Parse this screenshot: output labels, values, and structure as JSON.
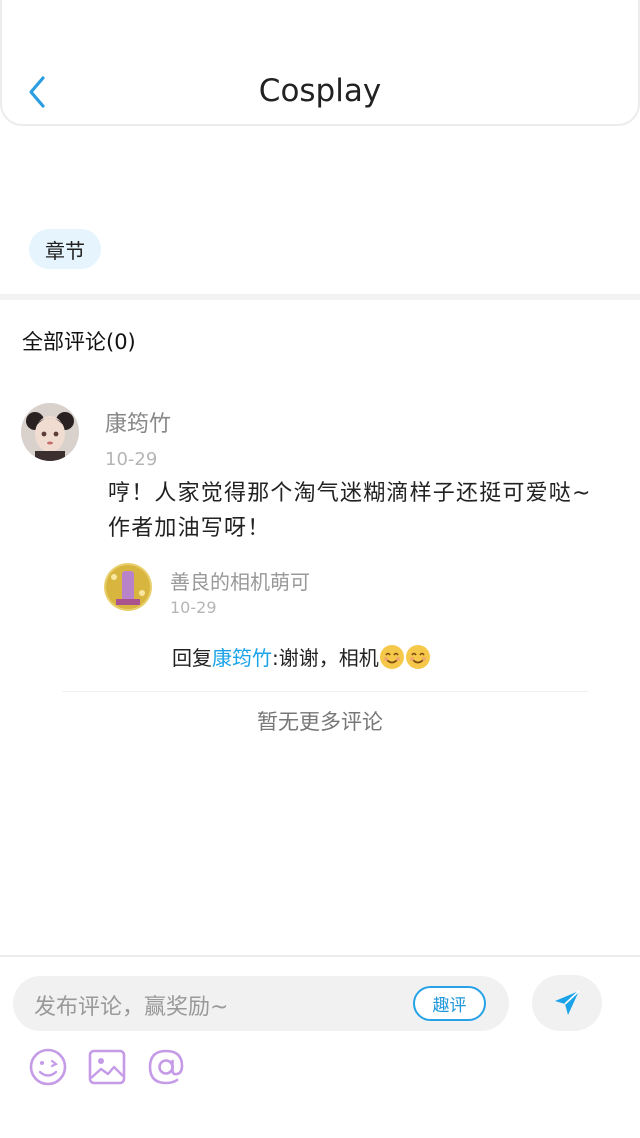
{
  "header": {
    "title": "Cosplay",
    "back_icon": "chevron-left-icon"
  },
  "tag": {
    "label": "章节"
  },
  "comments": {
    "title": "全部评论(0)",
    "main": {
      "user": "康筠竹",
      "date": "10-29",
      "text": "哼！人家觉得那个淘气迷糊滴样子还挺可爱哒~作者加油写呀！"
    },
    "reply": {
      "user": "善良的相机萌可",
      "date": "10-29",
      "prefix": "回复",
      "target": "康筠竹",
      "body": ":谢谢，相机"
    },
    "no_more": "暂无更多评论"
  },
  "composer": {
    "placeholder": "发布评论，赢奖励~",
    "quping_label": "趣评",
    "send_icon": "send-icon",
    "tools": [
      "emoji-icon",
      "image-icon",
      "at-icon"
    ]
  },
  "colors": {
    "accent": "#1aa3e8",
    "tag_bg": "#e6f4fd",
    "tool_purple": "#c59be8"
  }
}
